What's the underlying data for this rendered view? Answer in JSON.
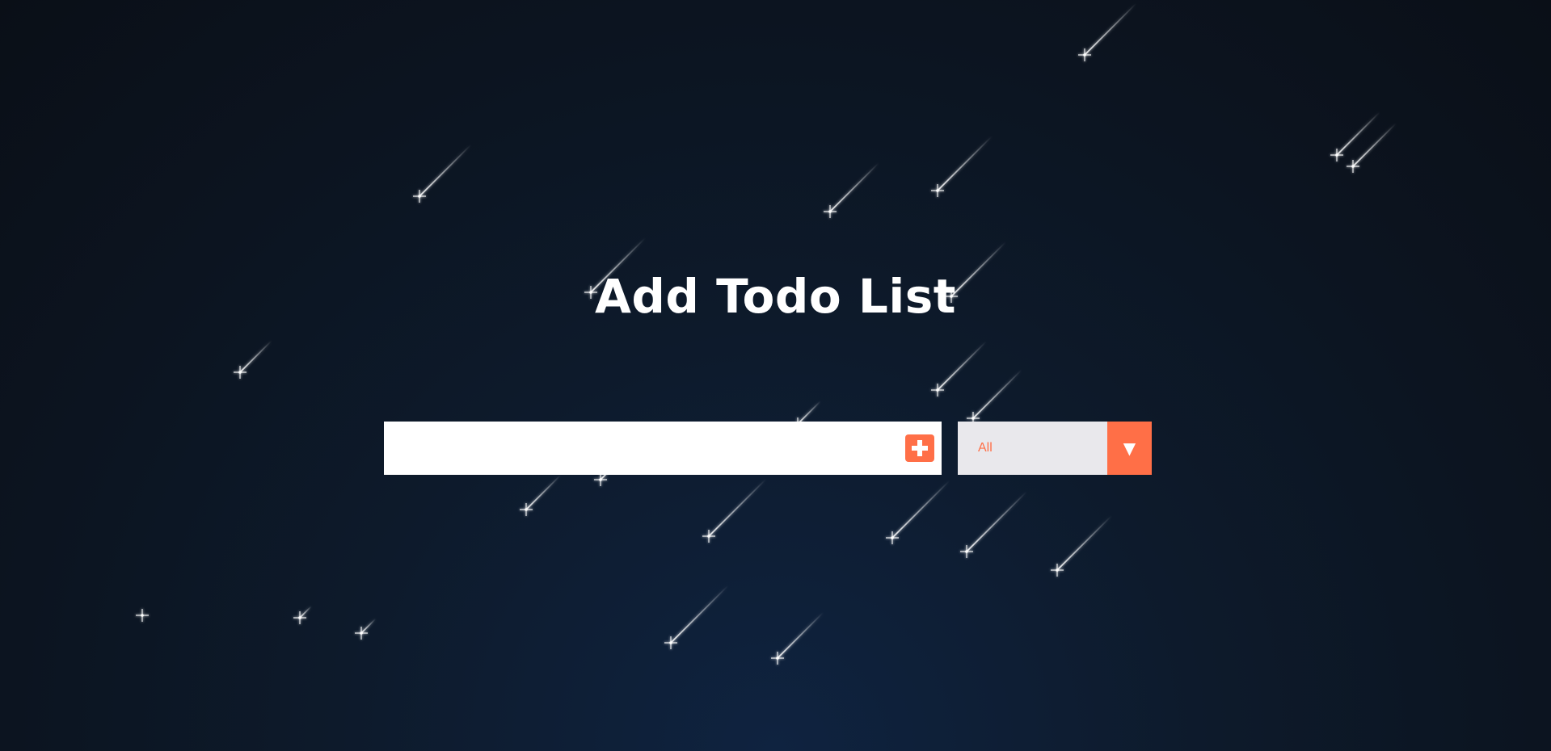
{
  "header": {
    "title": "Add Todo List"
  },
  "form": {
    "input_value": "",
    "input_placeholder": "",
    "add_icon": "plus-icon",
    "filter": {
      "selected": "All",
      "arrow_glyph": "▼",
      "arrow_icon": "caret-down-icon"
    }
  },
  "colors": {
    "accent": "#ff6f47",
    "title": "#ffffff",
    "select_bg": "#e9e8ec",
    "background": "#0c1420"
  }
}
